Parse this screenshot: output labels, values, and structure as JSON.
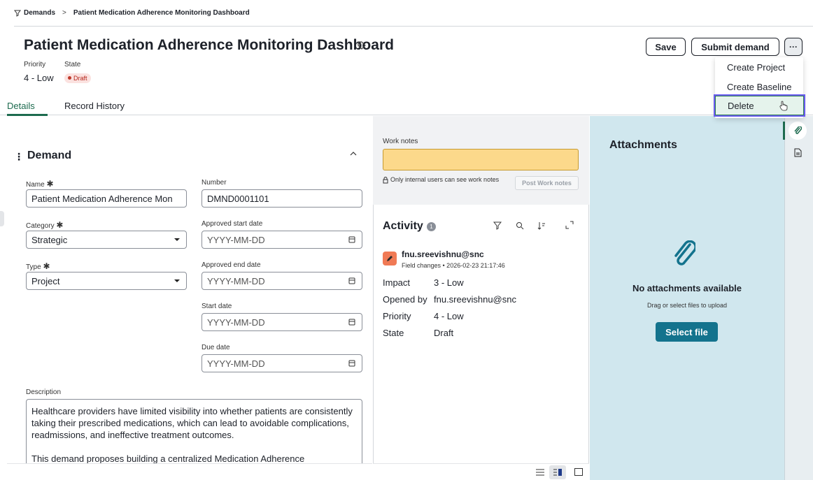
{
  "breadcrumb": {
    "root": "Demands",
    "current": "Patient Medication Adherence Monitoring Dashboard"
  },
  "header": {
    "title": "Patient Medication Adherence Monitoring Dashboard",
    "priority_label": "Priority",
    "priority_value": "4 - Low",
    "state_label": "State",
    "state_value": "Draft",
    "save_label": "Save",
    "submit_label": "Submit demand",
    "more_label": "···"
  },
  "menu": {
    "items": [
      {
        "label": "Create Project"
      },
      {
        "label": "Create Baseline"
      },
      {
        "label": "Delete"
      }
    ]
  },
  "tabs": [
    {
      "label": "Details"
    },
    {
      "label": "Record History"
    }
  ],
  "form": {
    "section_title": "Demand",
    "name_label": "Name",
    "name_value": "Patient Medication Adherence Mon",
    "number_label": "Number",
    "number_value": "DMND0001101",
    "category_label": "Category",
    "category_value": "Strategic",
    "type_label": "Type",
    "type_value": "Project",
    "approved_start_label": "Approved start date",
    "approved_end_label": "Approved end date",
    "start_label": "Start date",
    "due_label": "Due date",
    "date_placeholder": "YYYY-MM-DD",
    "description_label": "Description",
    "description_p1": "Healthcare providers have limited visibility into whether patients are consistently taking their prescribed medications, which can lead to avoidable complications, readmissions, and ineffective treatment outcomes.",
    "description_p2": "This demand proposes building a centralized Medication Adherence"
  },
  "worknotes": {
    "label": "Work notes",
    "note": "Only internal users can see work notes",
    "post_label": "Post Work notes"
  },
  "activity": {
    "title": "Activity",
    "count": "1",
    "user": "fnu.sreevishnu@snc",
    "subtitle": "Field changes • 2026-02-23 21:17:46",
    "rows": [
      {
        "label": "Impact",
        "value": "3 - Low"
      },
      {
        "label": "Opened by",
        "value": "fnu.sreevishnu@snc"
      },
      {
        "label": "Priority",
        "value": "4 - Low"
      },
      {
        "label": "State",
        "value": "Draft"
      }
    ]
  },
  "attachments": {
    "title": "Attachments",
    "empty_title": "No attachments available",
    "empty_sub": "Drag or select files to upload",
    "select_label": "Select file"
  },
  "colors": {
    "accent": "#1d6b4f",
    "attach_bg": "#d0e7ee",
    "select_btn": "#13738d",
    "worknotes": "#fcd98b"
  }
}
